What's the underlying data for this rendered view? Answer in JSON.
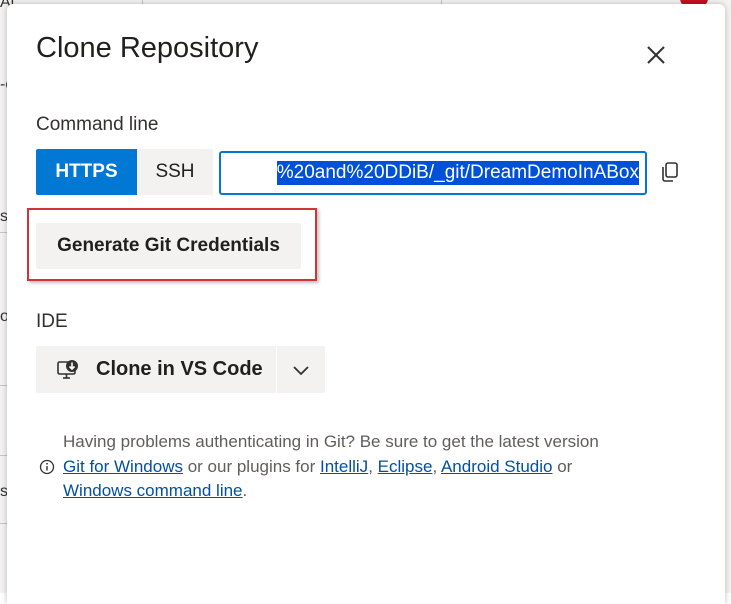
{
  "background": {
    "fragments": [
      "Al",
      "-c",
      "s'",
      "oc",
      "s"
    ]
  },
  "dialog": {
    "title": "Clone Repository",
    "close_label": "Close",
    "command_line": {
      "label": "Command line",
      "protocols": [
        "HTTPS",
        "SSH"
      ],
      "selected_protocol": "HTTPS",
      "url_visible": "%20and%20DDiB/_git/DreamDemoInABox"
    },
    "generate_credentials_label": "Generate Git Credentials",
    "ide": {
      "label": "IDE",
      "clone_label": "Clone in VS Code"
    },
    "info": {
      "line1": "Having problems authenticating in Git? Be sure to get the latest version",
      "link_git_windows": "Git for Windows",
      "text_or_plugins": " or our plugins for ",
      "link_intellij": "IntelliJ",
      "comma1": ", ",
      "link_eclipse": "Eclipse",
      "comma2": ", ",
      "link_android": "Android Studio",
      "text_or": " or",
      "link_cmd": "Windows command line",
      "period": "."
    }
  },
  "colors": {
    "accent": "#0078d4",
    "highlight_border": "#d13438",
    "link": "#0050a5"
  }
}
